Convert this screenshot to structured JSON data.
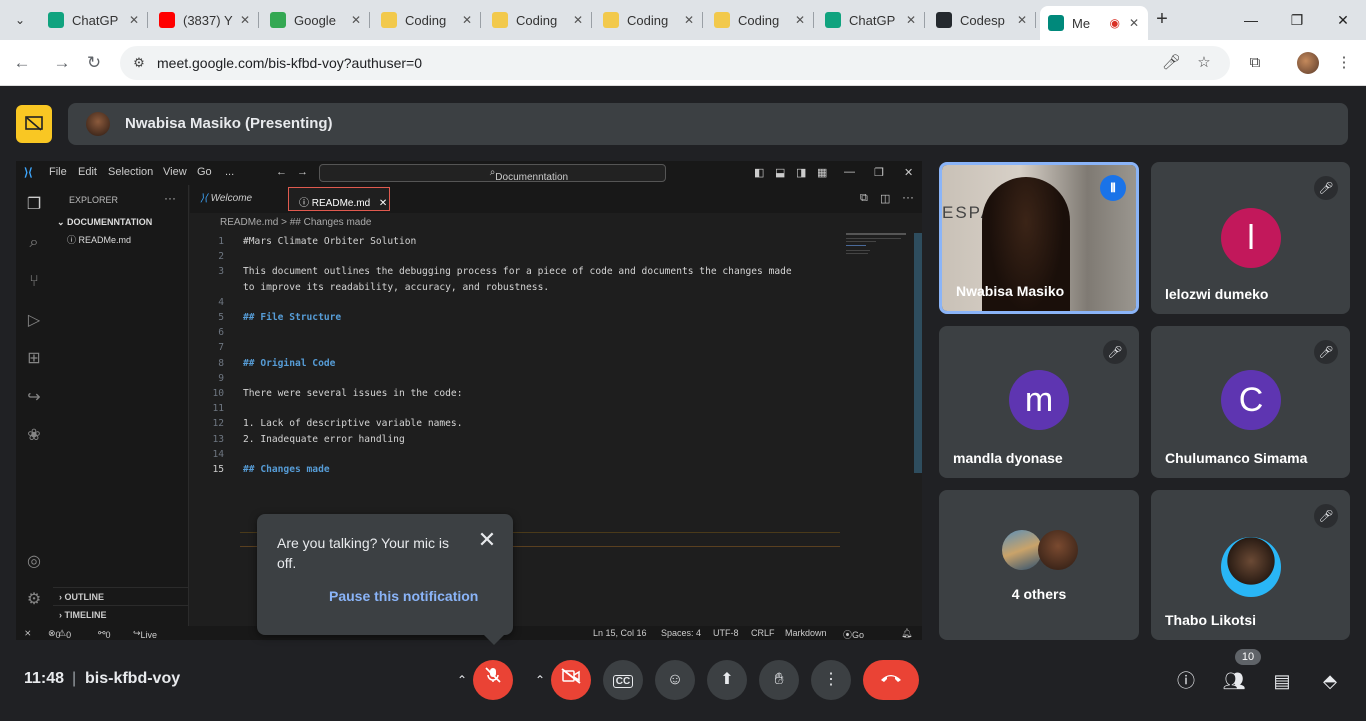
{
  "browser": {
    "tabs": [
      {
        "label": "ChatGP",
        "icon": "chatgpt-icon",
        "color": "#10a37f"
      },
      {
        "label": "(3837) Y",
        "icon": "youtube-icon",
        "color": "#ff0000"
      },
      {
        "label": "Google",
        "icon": "google-classroom-icon",
        "color": "#34a853"
      },
      {
        "label": "Coding",
        "icon": "coding-icon",
        "color": "#f2c94c"
      },
      {
        "label": "Coding",
        "icon": "coding-icon",
        "color": "#f2c94c"
      },
      {
        "label": "Coding",
        "icon": "coding-icon",
        "color": "#f2c94c"
      },
      {
        "label": "Coding",
        "icon": "coding-icon",
        "color": "#f2c94c"
      },
      {
        "label": "ChatGP",
        "icon": "chatgpt-icon",
        "color": "#10a37f"
      },
      {
        "label": "Codesp",
        "icon": "github-icon",
        "color": "#24292e"
      },
      {
        "label": "Me",
        "icon": "meet-icon",
        "color": "#00897b",
        "active": true
      }
    ],
    "url": "meet.google.com/bis-kfbd-voy?authuser=0"
  },
  "meet": {
    "presenter": "Nwabisa Masiko (Presenting)",
    "time": "11:48",
    "meeting_code": "bis-kfbd-voy",
    "people_count": "10",
    "participants": [
      {
        "name": "Nwabisa Masiko",
        "initial": "",
        "color": "",
        "speaking": true
      },
      {
        "name": "lelozwi dumeko",
        "initial": "l",
        "color": "#c2185b"
      },
      {
        "name": "mandla dyonase",
        "initial": "m",
        "color": "#5e35b1"
      },
      {
        "name": "Chulumanco Simama",
        "initial": "C",
        "color": "#5e35b1"
      },
      {
        "name": "4 others",
        "initial": "",
        "color": ""
      },
      {
        "name": "Thabo Likotsi",
        "initial": "",
        "color": ""
      }
    ],
    "notification": {
      "message": "Are you talking? Your mic is off.",
      "action": "Pause this notification"
    }
  },
  "vscode": {
    "menu": [
      "File",
      "Edit",
      "Selection",
      "View",
      "Go",
      "..."
    ],
    "search": "Documenntation",
    "explorer_label": "EXPLORER",
    "folder": "DOCUMENNTATION",
    "file": "READMe.md",
    "outline": "OUTLINE",
    "timeline": "TIMELINE",
    "tabs": [
      "Welcome",
      "READMe.md"
    ],
    "breadcrumb": "READMe.md  >  ## Changes made",
    "lines": [
      {
        "n": "1",
        "text": "#Mars Climate Orbiter Solution",
        "h": false
      },
      {
        "n": "2",
        "text": "",
        "h": false
      },
      {
        "n": "3",
        "text": "This document outlines the debugging process for a piece of code and documents the changes made",
        "h": false
      },
      {
        "n": "",
        "text": "to improve its readability, accuracy, and robustness.",
        "h": false
      },
      {
        "n": "4",
        "text": "",
        "h": false
      },
      {
        "n": "5",
        "text": "## File Structure",
        "h": true
      },
      {
        "n": "6",
        "text": "",
        "h": false
      },
      {
        "n": "7",
        "text": "",
        "h": false
      },
      {
        "n": "8",
        "text": "## Original Code",
        "h": true
      },
      {
        "n": "9",
        "text": "",
        "h": false
      },
      {
        "n": "10",
        "text": "There were several issues in the code:",
        "h": false
      },
      {
        "n": "11",
        "text": "",
        "h": false
      },
      {
        "n": "12",
        "text": "1. Lack of descriptive variable names.",
        "h": false
      },
      {
        "n": "13",
        "text": "2. Inadequate error handling",
        "h": false
      },
      {
        "n": "14",
        "text": "",
        "h": false
      },
      {
        "n": "15",
        "text": "## Changes made",
        "h": true
      }
    ],
    "status": {
      "errors": "0",
      "warnings": "0",
      "ports": "0",
      "live_share": "Live Share",
      "position": "Ln 15, Col 16",
      "spaces": "Spaces: 4",
      "encoding": "UTF-8",
      "eol": "CRLF",
      "language": "Markdown",
      "go_live": "Go Live"
    }
  },
  "colors": {
    "meet_bg": "#202124",
    "tile_bg": "#3c4043",
    "end_call": "#ea4335",
    "present_btn": "#f9c723",
    "accent": "#8ab4f8"
  }
}
